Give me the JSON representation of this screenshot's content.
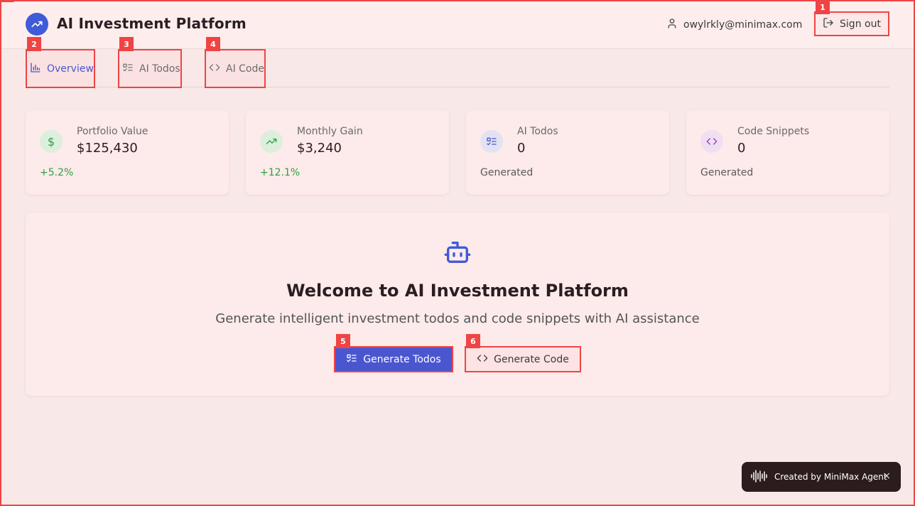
{
  "header": {
    "app_title": "AI Investment Platform",
    "user_email": "owylrkly@minimax.com",
    "signout_label": "Sign out",
    "logo_icon": "trending-up-icon",
    "brand_color": "#3f5bd8"
  },
  "badges": [
    "1",
    "2",
    "3",
    "4",
    "5",
    "6"
  ],
  "tabs": [
    {
      "label": "Overview",
      "icon": "bar-chart-icon",
      "active": true
    },
    {
      "label": "AI Todos",
      "icon": "list-todo-icon",
      "active": false
    },
    {
      "label": "AI Code",
      "icon": "code-icon",
      "active": false
    }
  ],
  "stats": [
    {
      "label": "Portfolio Value",
      "value": "$125,430",
      "sub": "+5.2%",
      "icon": "dollar-icon",
      "icon_color": "#2f9e44",
      "icon_bg": "#dcefdc"
    },
    {
      "label": "Monthly Gain",
      "value": "$3,240",
      "sub": "+12.1%",
      "icon": "trending-up-icon",
      "icon_color": "#2f9e44",
      "icon_bg": "#dcefdc"
    },
    {
      "label": "AI Todos",
      "value": "0",
      "sub": "Generated",
      "icon": "list-todo-icon",
      "icon_color": "#4a56d0",
      "icon_bg": "#e2e2f2"
    },
    {
      "label": "Code Snippets",
      "value": "0",
      "sub": "Generated",
      "icon": "code-icon",
      "icon_color": "#9b3fc8",
      "icon_bg": "#f0dff2"
    }
  ],
  "welcome": {
    "title": "Welcome to AI Investment Platform",
    "subtitle": "Generate intelligent investment todos and code snippets with AI assistance",
    "primary_button": "Generate Todos",
    "secondary_button": "Generate Code",
    "icon": "bot-icon"
  },
  "toast": {
    "text": "Created by MiniMax Agent",
    "close": "×",
    "icon": "audio-wave-icon"
  }
}
